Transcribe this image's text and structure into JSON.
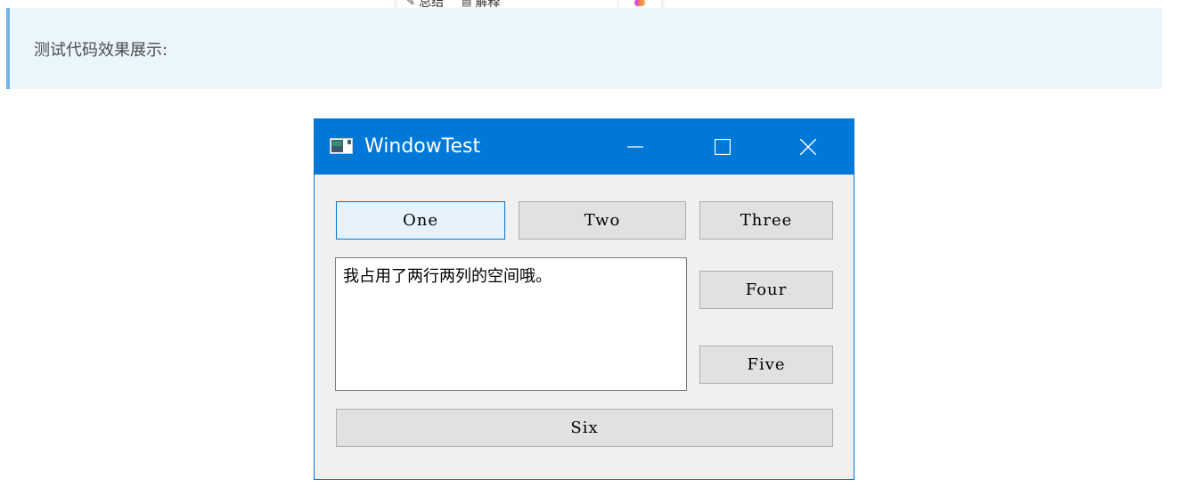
{
  "toolbar": {
    "item1_label": "总结",
    "item2_label": "解释"
  },
  "note": {
    "text": "测试代码效果展示:"
  },
  "window": {
    "title": "WindowTest",
    "title_bar_color": "#0078d7",
    "buttons": {
      "one": "One",
      "two": "Two",
      "three": "Three",
      "four": "Four",
      "five": "Five",
      "six": "Six"
    },
    "textbox_text": "我占用了两行两列的空间哦。"
  }
}
